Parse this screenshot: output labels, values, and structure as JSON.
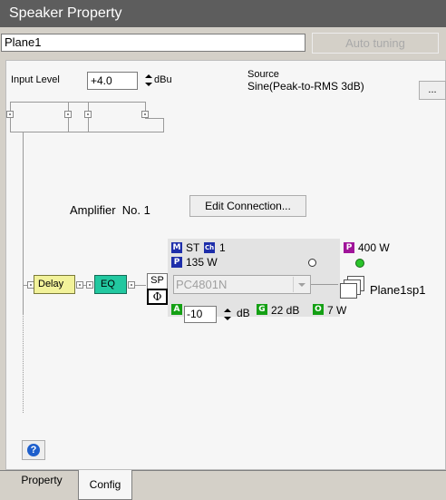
{
  "window": {
    "title": "Speaker Property"
  },
  "name_field": {
    "value": "Plane1"
  },
  "auto_tuning": {
    "label": "Auto tuning"
  },
  "input_level": {
    "label": "Input Level",
    "value": "+4.0",
    "unit": "dBu"
  },
  "source": {
    "label": "Source",
    "value": "Sine(Peak-to-RMS 3dB)",
    "browse_label": "..."
  },
  "amplifier": {
    "label": "Amplifier  No. 1",
    "edit_button": "Edit Connection..."
  },
  "chain": {
    "delay": "Delay",
    "eq": "EQ",
    "sp": "SP",
    "phase": "Φ"
  },
  "amp_info": {
    "mode_badge": "M",
    "mode": "ST",
    "ch_badge": "Ch",
    "channel": "1",
    "power_badge": "P",
    "power": "135 W",
    "rated_badge": "P",
    "rated_power": "400 W",
    "model": "PC4801N",
    "att_badge": "A",
    "att_value": "-10",
    "att_unit": "dB",
    "gain_badge": "G",
    "gain": "22 dB",
    "out_badge": "O",
    "output": "7 W"
  },
  "speaker": {
    "label": "Plane1sp1"
  },
  "help": {
    "label": "?"
  },
  "tabs": [
    {
      "label": "Property"
    },
    {
      "label": "Config"
    }
  ],
  "colors": {
    "titlebar": "#5d5d5d",
    "delay": "#f2f29a",
    "eq": "#22c8a0",
    "badge_blue": "#1e2eaa",
    "badge_purple": "#a0149a",
    "badge_green": "#14a014",
    "led_green": "#2bc42b"
  }
}
